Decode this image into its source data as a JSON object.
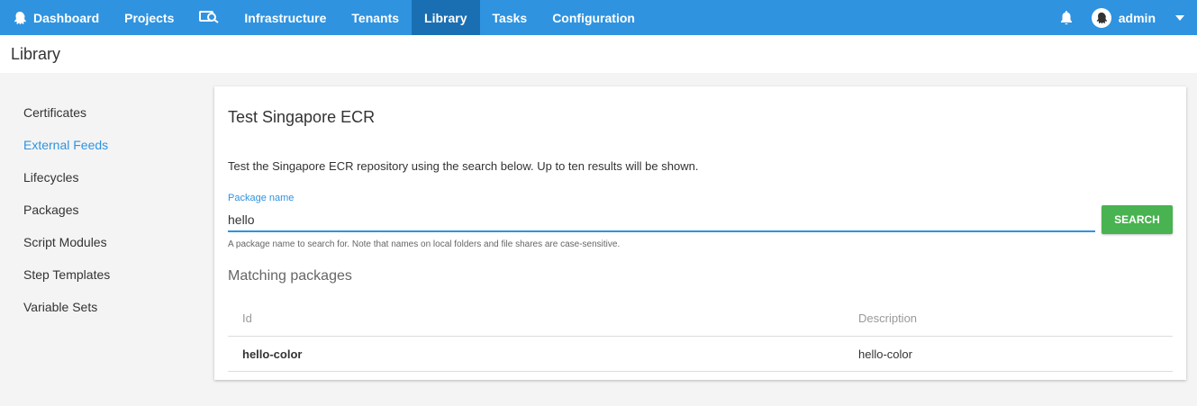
{
  "nav": {
    "items": [
      {
        "label": "Dashboard",
        "icon": "octopus-icon"
      },
      {
        "label": "Projects"
      },
      {
        "label": "",
        "icon": "machines-search-icon"
      },
      {
        "label": "Infrastructure"
      },
      {
        "label": "Tenants"
      },
      {
        "label": "Library",
        "active": true
      },
      {
        "label": "Tasks"
      },
      {
        "label": "Configuration"
      }
    ],
    "user": "admin",
    "accent": "#2f93e0",
    "active_bg": "#1a6fb3"
  },
  "page": {
    "title": "Library"
  },
  "sidebar": {
    "items": [
      {
        "label": "Certificates"
      },
      {
        "label": "External Feeds",
        "active": true
      },
      {
        "label": "Lifecycles"
      },
      {
        "label": "Packages"
      },
      {
        "label": "Script Modules"
      },
      {
        "label": "Step Templates"
      },
      {
        "label": "Variable Sets"
      }
    ]
  },
  "card": {
    "title": "Test Singapore ECR",
    "description": "Test the Singapore ECR repository using the search below. Up to ten results will be shown.",
    "field_label": "Package name",
    "field_value": "hello",
    "search_label": "SEARCH",
    "hint": "A package name to search for. Note that names on local folders and file shares are case-sensitive.",
    "results_title": "Matching packages",
    "table": {
      "headers": [
        "Id",
        "Description"
      ],
      "rows": [
        {
          "id": "hello-color",
          "description": "hello-color"
        }
      ]
    },
    "button_color": "#48b350"
  }
}
